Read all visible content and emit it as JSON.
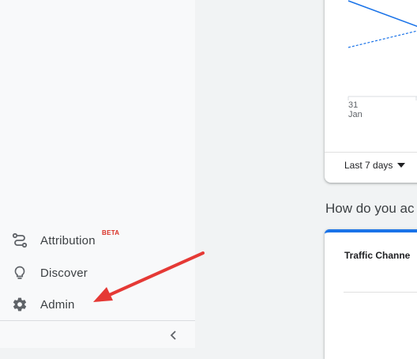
{
  "sidebar": {
    "items": [
      {
        "label": "Attribution",
        "badge": "BETA",
        "icon": "attribution-icon"
      },
      {
        "label": "Discover",
        "icon": "lightbulb-icon"
      },
      {
        "label": "Admin",
        "icon": "gear-icon"
      }
    ],
    "collapse_icon": "chevron-left-icon"
  },
  "overview_card": {
    "chart_data": {
      "type": "line",
      "x_tick_labels": [
        {
          "day": "31",
          "month": "Jan"
        }
      ],
      "series": [
        {
          "style": "solid",
          "color": "#1a73e8"
        },
        {
          "style": "dashed",
          "color": "#1a73e8"
        }
      ]
    },
    "date_range": "Last 7 days"
  },
  "section_heading": "How do you ac",
  "traffic_card": {
    "title": "Traffic Channe",
    "accent_color": "#1a73e8"
  },
  "annotation": {
    "arrow_color": "#e53935",
    "points_to": "Admin"
  }
}
